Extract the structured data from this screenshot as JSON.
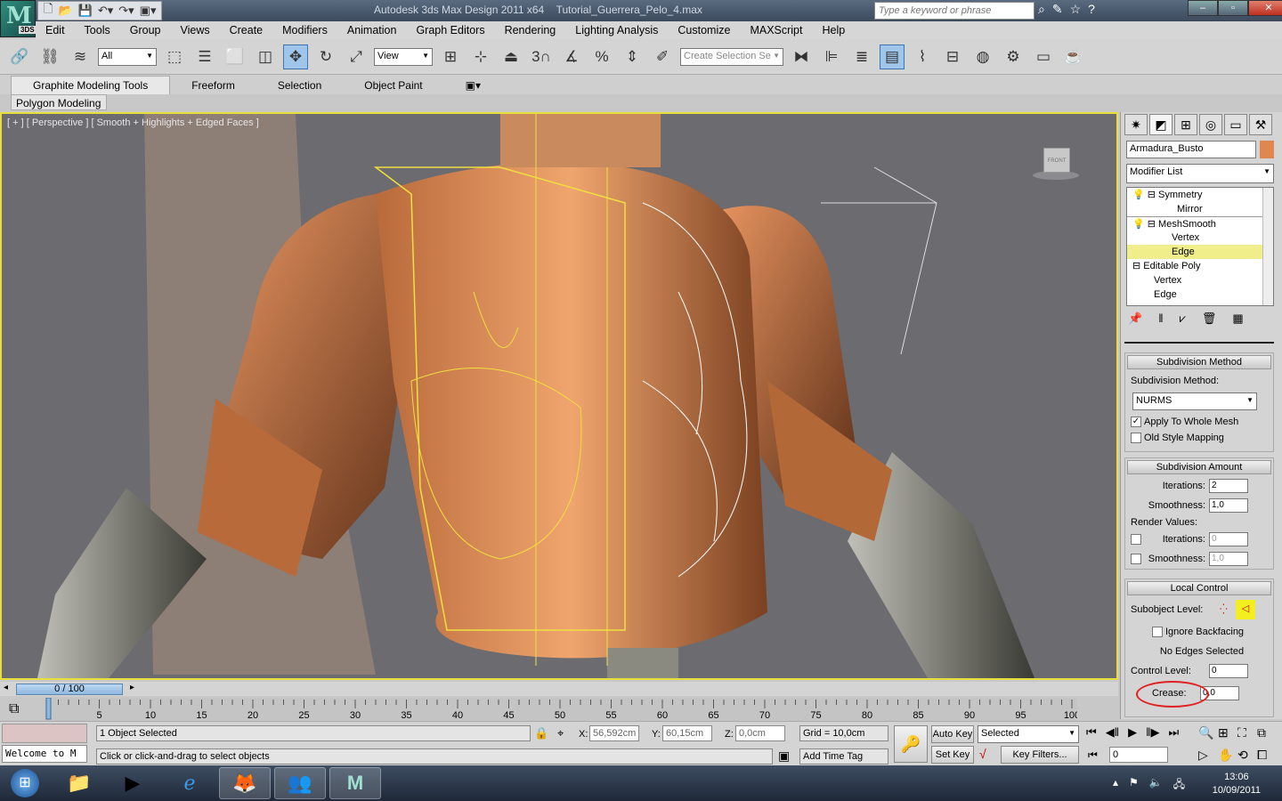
{
  "app": {
    "logo_text": "3DS",
    "title": "Autodesk 3ds Max Design 2011 x64",
    "file": "Tutorial_Guerrera_Pelo_4.max",
    "search_placeholder": "Type a keyword or phrase"
  },
  "menu": [
    "Edit",
    "Tools",
    "Group",
    "Views",
    "Create",
    "Modifiers",
    "Animation",
    "Graph Editors",
    "Rendering",
    "Lighting Analysis",
    "Customize",
    "MAXScript",
    "Help"
  ],
  "toolbar": {
    "selection_filter": "All",
    "ref_coord": "View",
    "named_selection": "Create Selection Se",
    "snap_3": "3"
  },
  "ribbon": {
    "tabs": [
      "Graphite Modeling Tools",
      "Freeform",
      "Selection",
      "Object Paint"
    ],
    "active": "Graphite Modeling Tools",
    "panel": "Polygon Modeling"
  },
  "viewport": {
    "label": "[ + ] [ Perspective ] [ Smooth + Highlights + Edged Faces ]",
    "viewcube": "FRONT"
  },
  "command_panel": {
    "object_name": "Armadura_Busto",
    "object_color": "#e0874f",
    "modifier_list": "Modifier List",
    "stack": [
      {
        "label": "Symmetry",
        "level": 0,
        "bulb": true,
        "box": true
      },
      {
        "label": "Mirror",
        "level": 1
      },
      {
        "label": "MeshSmooth",
        "level": 0,
        "bulb": true,
        "box": true
      },
      {
        "label": "Vertex",
        "level": 1
      },
      {
        "label": "Edge",
        "level": 1,
        "selected": true
      },
      {
        "label": "Editable Poly",
        "level": 0,
        "box": true
      },
      {
        "label": "Vertex",
        "level": 1
      },
      {
        "label": "Edge",
        "level": 1
      }
    ],
    "subdivision_method": {
      "title": "Subdivision Method",
      "label": "Subdivision Method:",
      "value": "NURMS",
      "apply_whole": "Apply To Whole Mesh",
      "apply_whole_checked": true,
      "old_style": "Old Style Mapping",
      "old_style_checked": false
    },
    "subdivision_amount": {
      "title": "Subdivision Amount",
      "iterations_label": "Iterations:",
      "iterations": "2",
      "smoothness_label": "Smoothness:",
      "smoothness": "1,0",
      "render_values": "Render Values:",
      "r_iterations": "0",
      "r_smoothness": "1,0"
    },
    "local_control": {
      "title": "Local Control",
      "subobject_label": "Subobject Level:",
      "ignore_backfacing": "Ignore Backfacing",
      "status": "No Edges Selected",
      "control_level_label": "Control Level:",
      "control_level": "0",
      "crease_label": "Crease:",
      "crease": "0,0"
    }
  },
  "timeline": {
    "slider": "0 / 100",
    "ticks": [
      "0",
      "5",
      "10",
      "15",
      "20",
      "25",
      "30",
      "35",
      "40",
      "45",
      "50",
      "55",
      "60",
      "65",
      "70",
      "75",
      "80",
      "85",
      "90",
      "95",
      "100"
    ]
  },
  "status": {
    "selected": "1 Object Selected",
    "prompt": "Click or click-and-drag to select objects",
    "maxscript": "Welcome to M",
    "x_label": "X:",
    "x": "56,592cm",
    "y_label": "Y:",
    "y": "60,15cm",
    "z_label": "Z:",
    "z": "0,0cm",
    "grid": "Grid = 10,0cm",
    "add_time_tag": "Add Time Tag",
    "auto_key": "Auto Key",
    "set_key": "Set Key",
    "key_mode": "Selected",
    "key_filters": "Key Filters...",
    "frame": "0"
  },
  "taskbar": {
    "time": "13:06",
    "date": "10/09/2011"
  }
}
